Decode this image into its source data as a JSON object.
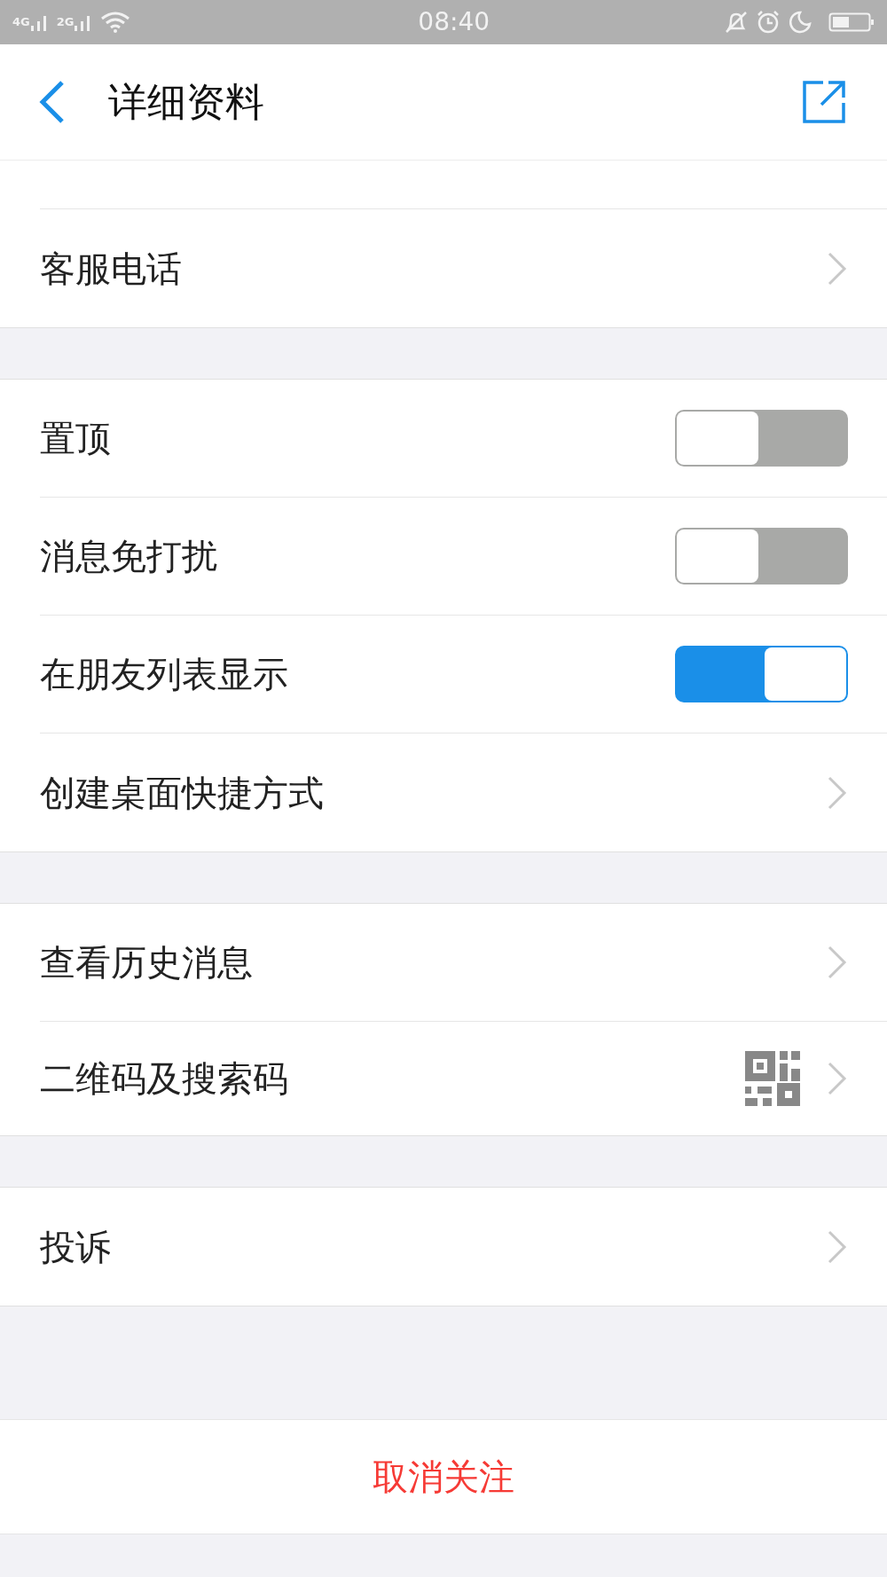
{
  "status_bar": {
    "network_1": "4G",
    "network_2": "2G",
    "time": "08:40"
  },
  "header": {
    "title": "详细资料"
  },
  "groups": [
    {
      "rows": [
        {
          "kind": "cut"
        },
        {
          "kind": "link",
          "label": "客服电话"
        }
      ]
    },
    {
      "rows": [
        {
          "kind": "toggle",
          "label": "置顶",
          "on": false
        },
        {
          "kind": "toggle",
          "label": "消息免打扰",
          "on": false
        },
        {
          "kind": "toggle",
          "label": "在朋友列表显示",
          "on": true
        },
        {
          "kind": "link",
          "label": "创建桌面快捷方式"
        }
      ]
    },
    {
      "rows": [
        {
          "kind": "link",
          "label": "查看历史消息"
        },
        {
          "kind": "qr",
          "label": "二维码及搜索码"
        }
      ]
    },
    {
      "rows": [
        {
          "kind": "link",
          "label": "投诉"
        }
      ]
    }
  ],
  "unfollow_button": "取消关注"
}
